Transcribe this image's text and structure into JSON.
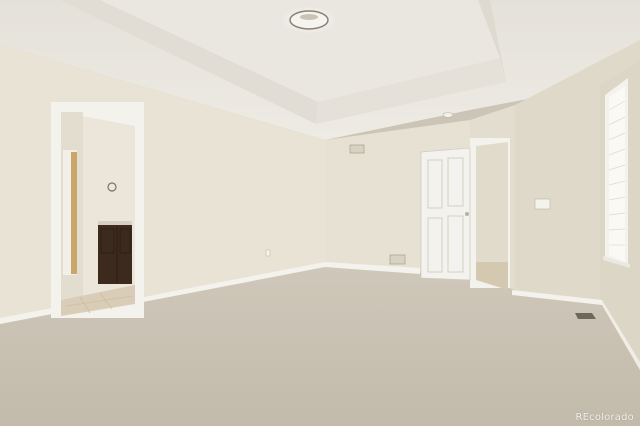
{
  "photo": {
    "subject": "empty-bedroom",
    "watermark": "REcolorado"
  },
  "colors": {
    "ceiling": "#ebe8e1",
    "wall": "#e7e2d4",
    "wall_shadow": "#dcd6c6",
    "carpet": "#c9c1b3",
    "trim": "#f4f2ec",
    "door": "#f3f2ee",
    "vanity": "#3c2a1e",
    "tile": "#d8ccb6"
  }
}
